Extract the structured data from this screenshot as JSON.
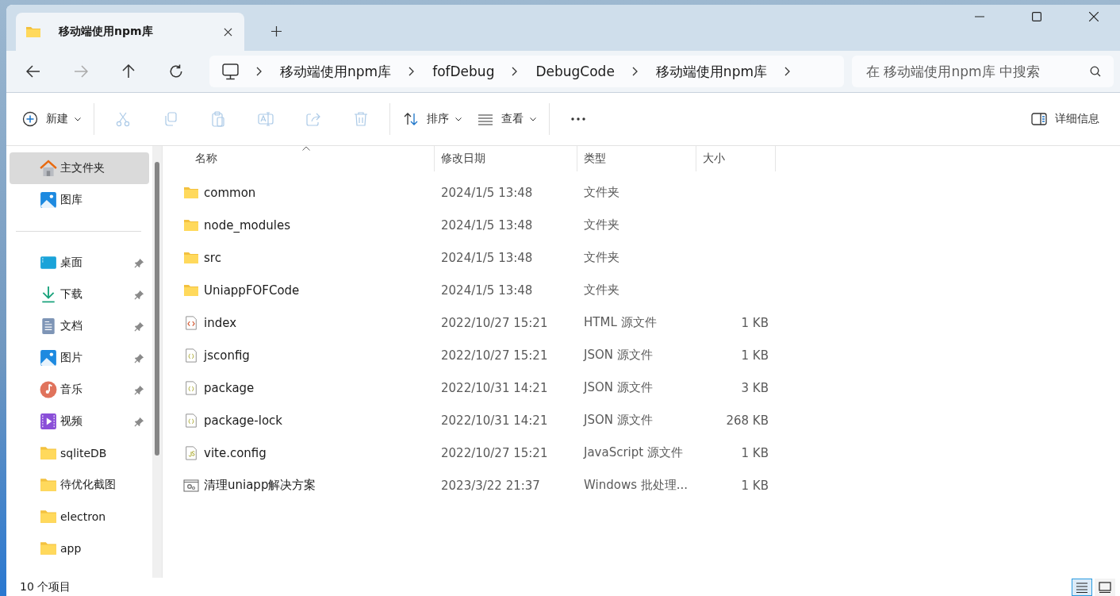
{
  "tabs": [
    {
      "label": "移动端使用npm库",
      "selected": true
    }
  ],
  "address": {
    "segments": [
      "移动端使用npm库",
      "fofDebug",
      "DebugCode",
      "移动端使用npm库"
    ]
  },
  "search": {
    "placeholder": "在 移动端使用npm库 中搜索"
  },
  "toolbar": [
    {
      "kind": "new",
      "label": "新建",
      "disabled": false
    },
    {
      "kind": "cut",
      "disabled": true
    },
    {
      "kind": "copy",
      "disabled": true
    },
    {
      "kind": "paste",
      "disabled": true
    },
    {
      "kind": "rename",
      "disabled": true
    },
    {
      "kind": "share",
      "disabled": true
    },
    {
      "kind": "delete",
      "disabled": true
    },
    {
      "kind": "sort",
      "label": "排序",
      "disabled": false
    },
    {
      "kind": "view",
      "label": "查看",
      "disabled": false
    },
    {
      "kind": "more",
      "disabled": false
    }
  ],
  "details": {
    "label": "详细信息"
  },
  "sidebar": {
    "items": [
      {
        "kind": "home",
        "label": "主文件夹",
        "selected": true,
        "pinned": false
      },
      {
        "kind": "gallery",
        "label": "图库",
        "selected": false,
        "pinned": false
      },
      {
        "kind": "divider"
      },
      {
        "kind": "desktop",
        "label": "桌面",
        "selected": false,
        "pinned": true
      },
      {
        "kind": "download",
        "label": "下载",
        "selected": false,
        "pinned": true
      },
      {
        "kind": "document",
        "label": "文档",
        "selected": false,
        "pinned": true
      },
      {
        "kind": "picture",
        "label": "图片",
        "selected": false,
        "pinned": true
      },
      {
        "kind": "music",
        "label": "音乐",
        "selected": false,
        "pinned": true
      },
      {
        "kind": "video",
        "label": "视频",
        "selected": false,
        "pinned": true
      },
      {
        "kind": "folder",
        "label": "sqliteDB",
        "selected": false,
        "pinned": false
      },
      {
        "kind": "folder",
        "label": "待优化截图",
        "selected": false,
        "pinned": false
      },
      {
        "kind": "folder",
        "label": "electron",
        "selected": false,
        "pinned": false
      },
      {
        "kind": "folder",
        "label": "app",
        "selected": false,
        "pinned": false
      }
    ]
  },
  "table": {
    "columns": [
      {
        "label": "名称",
        "sorted": true
      },
      {
        "label": "修改日期",
        "sorted": false
      },
      {
        "label": "类型",
        "sorted": false
      },
      {
        "label": "大小",
        "sorted": false
      }
    ],
    "rows": [
      {
        "kind": "folder",
        "name": "common",
        "date": "2024/1/5 13:48",
        "type": "文件夹"
      },
      {
        "kind": "folder",
        "name": "node_modules",
        "date": "2024/1/5 13:48",
        "type": "文件夹"
      },
      {
        "kind": "folder",
        "name": "src",
        "date": "2024/1/5 13:48",
        "type": "文件夹"
      },
      {
        "kind": "folder",
        "name": "UniappFOFCode",
        "date": "2024/1/5 13:48",
        "type": "文件夹"
      },
      {
        "kind": "html",
        "name": "index",
        "date": "2022/10/27 15:21",
        "type": "HTML 源文件",
        "size": "1 KB"
      },
      {
        "kind": "json",
        "name": "jsconfig",
        "date": "2022/10/27 15:21",
        "type": "JSON 源文件",
        "size": "1 KB"
      },
      {
        "kind": "json",
        "name": "package",
        "date": "2022/10/31 14:21",
        "type": "JSON 源文件",
        "size": "3 KB"
      },
      {
        "kind": "json",
        "name": "package-lock",
        "date": "2022/10/31 14:21",
        "type": "JSON 源文件",
        "size": "268 KB"
      },
      {
        "kind": "js",
        "name": "vite.config",
        "date": "2022/10/27 15:21",
        "type": "JavaScript 源文件",
        "size": "1 KB"
      },
      {
        "kind": "batch",
        "name": "清理uniapp解决方案",
        "date": "2023/3/22 21:37",
        "type": "Windows 批处理...",
        "size": "1 KB"
      }
    ]
  },
  "status_bar": {
    "count": "10 个项目",
    "views": [
      {
        "kind": "details",
        "selected": true
      },
      {
        "kind": "tiles",
        "selected": false
      }
    ]
  }
}
